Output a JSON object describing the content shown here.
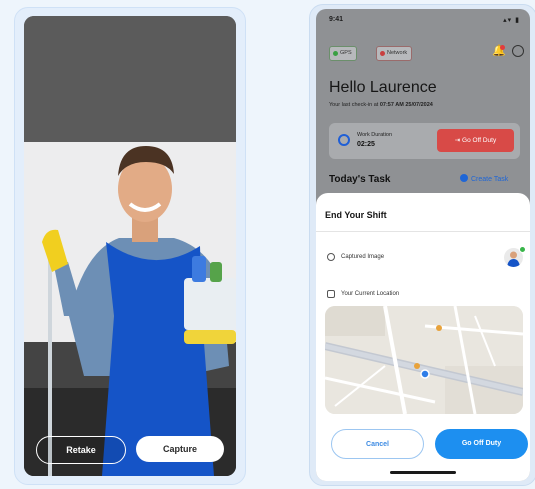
{
  "camera_screen": {
    "retake_label": "Retake",
    "capture_label": "Capture"
  },
  "app_screen": {
    "status": {
      "time": "9:41",
      "icons": "▴▾ ▮"
    },
    "chips": {
      "gps": "GPS",
      "network": "Network"
    },
    "greeting": "Hello Laurence",
    "subline_prefix": "Your last check-in at",
    "subline_value": "07:57 AM 25/07/2024",
    "work_duration": {
      "label": "Work Duration",
      "value": "02:25"
    },
    "off_duty_label": "Go Off Duty",
    "tasks": {
      "title": "Today's Task",
      "link": "Create Task"
    },
    "sheet": {
      "title": "End Your Shift",
      "captured_image_label": "Captured Image",
      "location_label": "Your Current Location",
      "cancel_label": "Cancel",
      "go_off_label": "Go Off Duty"
    },
    "colors": {
      "primary": "#1d8ff0",
      "danger": "#d84a47",
      "online": "#39b54a"
    }
  }
}
